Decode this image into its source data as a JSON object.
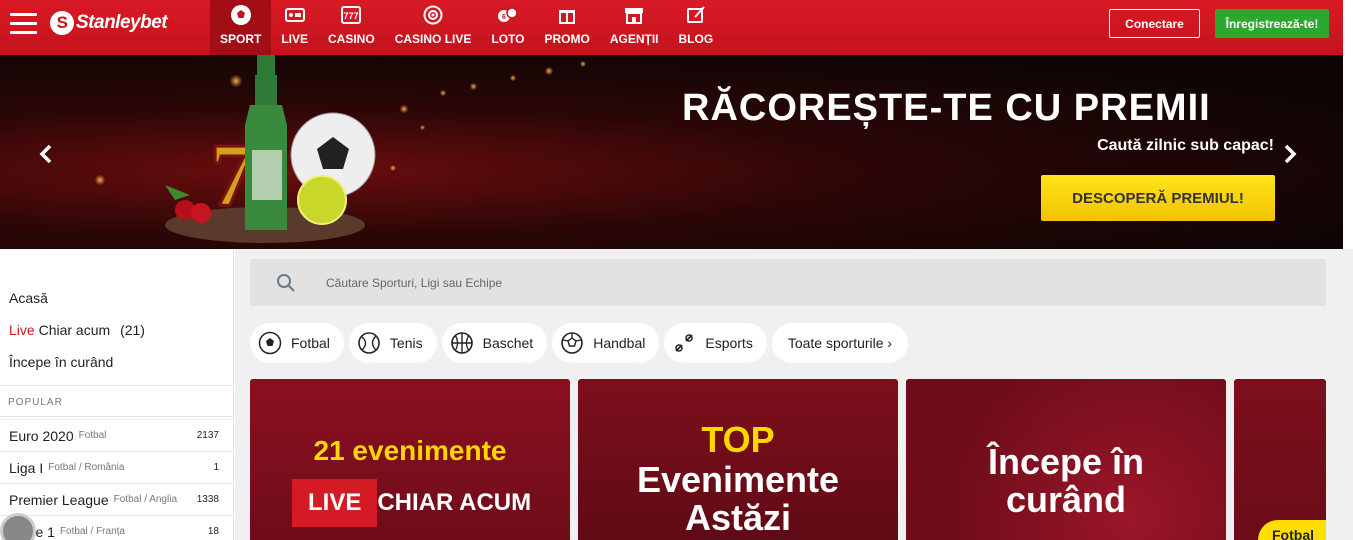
{
  "header": {
    "brand": "Stanleybet",
    "nav": [
      {
        "label": "SPORT",
        "icon": "soccer-ball-icon",
        "active": true
      },
      {
        "label": "LIVE",
        "icon": "live-tv-icon",
        "active": false
      },
      {
        "label": "CASINO",
        "icon": "slot-777-icon",
        "active": false
      },
      {
        "label": "CASINO LIVE",
        "icon": "roulette-icon",
        "active": false
      },
      {
        "label": "LOTO",
        "icon": "lottery-balls-icon",
        "active": false
      },
      {
        "label": "PROMO",
        "icon": "gift-icon",
        "active": false
      },
      {
        "label": "AGENȚII",
        "icon": "shop-icon",
        "active": false
      },
      {
        "label": "BLOG",
        "icon": "blog-icon",
        "active": false
      }
    ],
    "login_label": "Conectare",
    "register_label": "Înregistrează-te!"
  },
  "banner": {
    "title": "RĂCOREȘTE-TE CU PREMII",
    "subtitle": "Caută zilnic sub capac!",
    "cta_label": "DESCOPERĂ PREMIUL!"
  },
  "sidebar": {
    "home_label": "Acasă",
    "live_prefix": "Live",
    "live_label": "Chiar acum",
    "live_count": "(21)",
    "soon_label": "Începe în curând",
    "popular_title": "POPULAR",
    "popular": [
      {
        "name": "Euro 2020",
        "sub": "Fotbal",
        "count": "2137"
      },
      {
        "name": "Liga I",
        "sub": "Fotbal / România",
        "count": "1"
      },
      {
        "name": "Premier League",
        "sub": "Fotbal / Anglia",
        "count": "1338"
      },
      {
        "name": "Ligue 1",
        "sub": "Fotbal / Franța",
        "count": "18"
      }
    ]
  },
  "main": {
    "search_placeholder": "Căutare Sporturi, Ligi sau Echipe",
    "sports": [
      {
        "label": "Fotbal",
        "icon": "football-icon"
      },
      {
        "label": "Tenis",
        "icon": "tennis-ball-icon"
      },
      {
        "label": "Baschet",
        "icon": "basketball-icon"
      },
      {
        "label": "Handbal",
        "icon": "handball-icon"
      },
      {
        "label": "Esports",
        "icon": "gamepad-icon"
      }
    ],
    "all_sports_label": "Toate sporturile ›",
    "cards": {
      "live_count_text": "21 evenimente",
      "live_tag": "LIVE",
      "live_text": "CHIAR ACUM",
      "top_label": "TOP",
      "top_line1": "Evenimente",
      "top_line2": "Astăzi",
      "soon_line1": "Începe în",
      "soon_line2": "curând",
      "football_badge": "Fotbal"
    }
  },
  "colors": {
    "brand_red": "#d81a25",
    "register_green": "#2ea72e",
    "cta_yellow": "#ffd600"
  }
}
